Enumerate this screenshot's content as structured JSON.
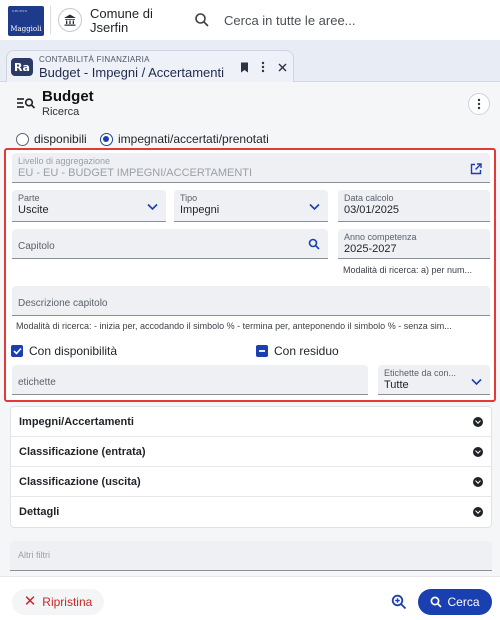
{
  "header": {
    "logo_text": "Maggioli",
    "logo_small": "GRUPPO",
    "comune": "Comune di Jserfin",
    "search_placeholder": "Cerca in tutte le aree..."
  },
  "tab": {
    "badge": "Ra",
    "kicker": "CONTABILITÀ FINANZIARIA",
    "title": "Budget - Impegni / Accertamenti"
  },
  "page": {
    "title": "Budget",
    "subtitle": "Ricerca"
  },
  "filters": {
    "radio_disponibili": "disponibili",
    "radio_impegnati": "impegnati/accertati/prenotati",
    "selected_radio": "impegnati/accertati/prenotati",
    "livello": {
      "label": "Livello di aggregazione",
      "value": "EU - EU - BUDGET IMPEGNI/ACCERTAMENTI"
    },
    "parte": {
      "label": "Parte",
      "value": "Uscite"
    },
    "tipo": {
      "label": "Tipo",
      "value": "Impegni"
    },
    "data_calcolo": {
      "label": "Data calcolo",
      "value": "03/01/2025"
    },
    "capitolo": {
      "label": "Capitolo"
    },
    "anno_competenza": {
      "label": "Anno competenza",
      "value": "2025-2027"
    },
    "hint_anno": "Modalità di ricerca: a) per num...",
    "descrizione": {
      "label": "Descrizione capitolo"
    },
    "hint_descrizione": "Modalità di ricerca: - inizia per, accodando il simbolo % - termina per, anteponendo il simbolo % - senza sim...",
    "con_disponibilita": "Con disponibilità",
    "con_residuo": "Con residuo",
    "etichette": {
      "label": "etichette"
    },
    "etichette_da": {
      "label": "Etichette da con...",
      "value": "Tutte"
    }
  },
  "accordion": [
    "Impegni/Accertamenti",
    "Classificazione (entrata)",
    "Classificazione (uscita)",
    "Dettagli"
  ],
  "altri_filtri": "Altri filtri",
  "footer": {
    "reset_label": "Ripristina",
    "search_label": "Cerca"
  },
  "colors": {
    "primary": "#1a3fb0",
    "danger": "#e53935"
  }
}
